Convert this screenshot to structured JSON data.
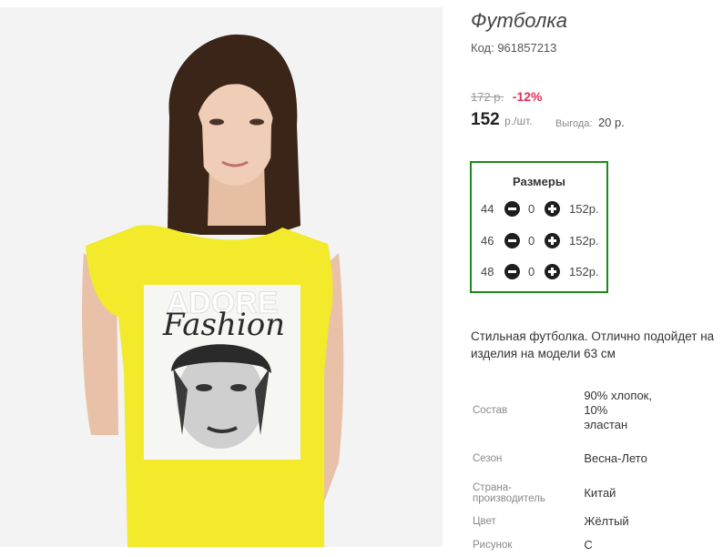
{
  "product": {
    "title": "Футболка",
    "code": "Код: 961857213"
  },
  "pricing": {
    "old_price": "172 р.",
    "discount": "-12%",
    "price": "152",
    "unit": "р./шт.",
    "savings_label": "Выгода:",
    "savings_value": "20 р."
  },
  "sizes": {
    "title": "Размеры",
    "rows": [
      {
        "size": "44",
        "qty": "0",
        "price": "152р."
      },
      {
        "size": "46",
        "qty": "0",
        "price": "152р."
      },
      {
        "size": "48",
        "qty": "0",
        "price": "152р."
      }
    ]
  },
  "description": {
    "line1": "Стильная футболка. Отлично подойдет на",
    "line2": "изделия на модели 63 см"
  },
  "properties": [
    {
      "label": "Состав",
      "value": "90% хлопок, 10% эластан"
    },
    {
      "label": "Сезон",
      "value": "Весна-Лето"
    },
    {
      "label": "Страна-производитель",
      "value": "Китай"
    },
    {
      "label": "Цвет",
      "value": "Жёлтый"
    },
    {
      "label": "Рисунок",
      "value": "С"
    }
  ],
  "photo": {
    "print_top": "ADORE",
    "print_script": "Fashion"
  },
  "colors": {
    "frame_green": "#1a8a1a",
    "discount_red": "#e0315a",
    "shirt_yellow": "#f2ea2a"
  }
}
